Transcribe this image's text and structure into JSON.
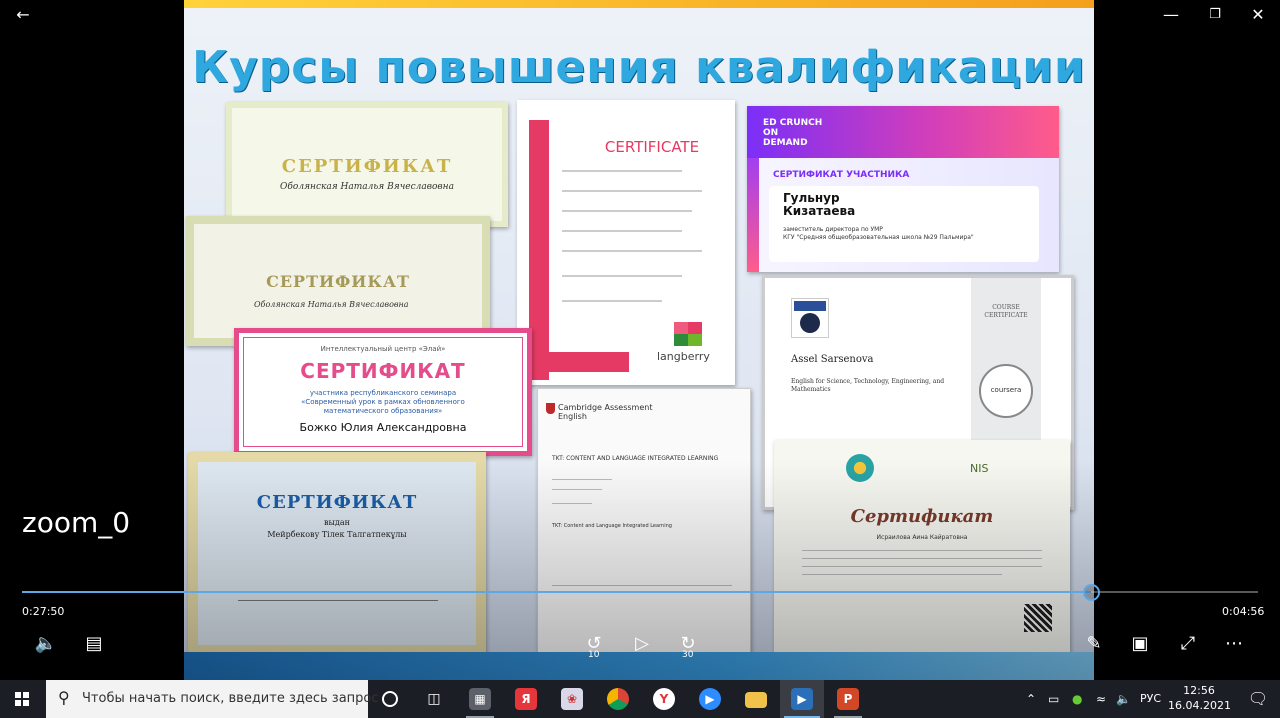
{
  "window": {
    "back_icon": "back-arrow-icon",
    "minimize_icon": "minimize-icon",
    "restore_icon": "restore-icon",
    "close_icon": "close-icon"
  },
  "slide": {
    "title": "Курсы повышения квалификации",
    "certificates": {
      "c1": {
        "heading": "СЕРТИФИКАТ",
        "name": "Оболянская Наталья Вячеславовна"
      },
      "c2": {
        "heading": "СЕРТИФИКАТ",
        "name": "Оболянская Наталья Вячеславовна"
      },
      "c3": {
        "heading": "CERTIFICATE",
        "brand": "langberry"
      },
      "c4": {
        "brand": "ED CRUNCH ON DEMAND",
        "label": "СЕРТИФИКАТ УЧАСТНИКА",
        "name": "Гульнур\nКизатаева",
        "position": "заместитель директора по УМР",
        "school": "КГУ \"Средняя общеобразовательная школа №29 Пальмира\""
      },
      "c5": {
        "org": "Интеллектуальный центр «Элай»",
        "heading": "СЕРТИФИКАТ",
        "subtitle": "участника республиканского семинара\n«Современный урок в рамках обновленного\nматематического образования»",
        "name": "Божко Юлия Александровна"
      },
      "c6": {
        "heading": "СЕРТИФИКАТ",
        "issued": "выдан",
        "name": "Мейрбекову Тілек Талгатпекұлы"
      },
      "c7": {
        "brand": "Cambridge Assessment\nEnglish",
        "heading": "TKT: CONTENT AND LANGUAGE INTEGRATED LEARNING",
        "module": "TKT: Content and Language Integrated Learning"
      },
      "c8": {
        "course_cert": "COURSE\nCERTIFICATE",
        "seal": "coursera",
        "name": "Assel Sarsenova",
        "course": "English for Science, Technology, Engineering, and\nMathematics"
      },
      "c9": {
        "heading": "Сертификат",
        "org": "NIS",
        "name": "Исраилова Аина Кайратовна"
      }
    }
  },
  "player": {
    "filename": "zoom_0",
    "elapsed": "0:27:50",
    "remaining": "0:04:56",
    "progress": 0.865,
    "skip_back": "10",
    "skip_forward": "30",
    "icons": {
      "volume": "volume-icon",
      "subtitles": "subtitles-icon",
      "skip_back": "skip-back-icon",
      "play": "play-icon",
      "skip_forward": "skip-forward-icon",
      "edit": "pen-icon",
      "mini": "mini-view-icon",
      "fullscreen": "fullscreen-icon",
      "more": "more-icon"
    }
  },
  "taskbar": {
    "search_placeholder": "Чтобы начать поиск, введите здесь запрос",
    "apps": [
      "cortana-icon",
      "task-view-icon",
      "calculator-icon",
      "yandex-browser-icon",
      "paint-icon",
      "chrome-icon",
      "yandex-icon",
      "zoom-icon",
      "file-explorer-icon",
      "movies-tv-icon",
      "powerpoint-icon"
    ],
    "tray": {
      "language": "РУС",
      "time": "12:56",
      "date": "16.04.2021"
    }
  }
}
